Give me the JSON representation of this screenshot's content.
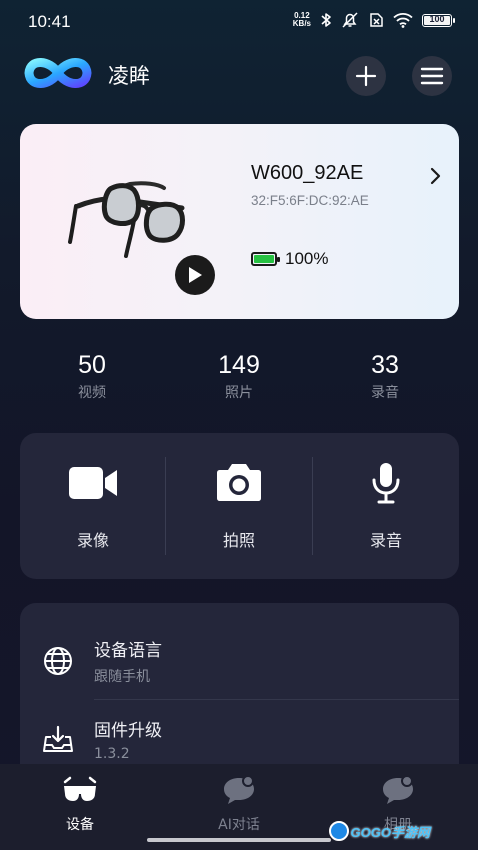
{
  "status_bar": {
    "time": "10:41",
    "net_speed_value": "0.12",
    "net_speed_unit": "KB/s",
    "battery_level": "100",
    "icons": [
      "bluetooth-icon",
      "mute-icon",
      "sim-x-icon",
      "wifi-icon",
      "battery-icon"
    ]
  },
  "header": {
    "app_name": "凌眸",
    "logo_icon": "infinity-logo-icon",
    "add_icon": "plus-icon",
    "menu_icon": "hamburger-icon"
  },
  "device": {
    "name": "W600_92AE",
    "mac": "32:F5:6F:DC:92:AE",
    "battery_text": "100%",
    "battery_fraction": 1.0,
    "battery_color": "#27c142"
  },
  "stats": [
    {
      "value": "50",
      "label": "视频"
    },
    {
      "value": "149",
      "label": "照片"
    },
    {
      "value": "33",
      "label": "录音"
    }
  ],
  "actions": [
    {
      "label": "录像",
      "icon": "video-camera-icon"
    },
    {
      "label": "拍照",
      "icon": "camera-icon"
    },
    {
      "label": "录音",
      "icon": "microphone-icon"
    }
  ],
  "settings": [
    {
      "title": "设备语言",
      "subtitle": "跟随手机",
      "icon": "globe-icon"
    },
    {
      "title": "固件升级",
      "subtitle": "1.3.2",
      "icon": "download-tray-icon"
    }
  ],
  "bottom_nav": [
    {
      "label": "设备",
      "icon": "glasses-icon",
      "active": true
    },
    {
      "label": "AI对话",
      "icon": "chat-bubble-icon",
      "active": false
    },
    {
      "label": "相册",
      "icon": "chat-bubble-icon",
      "active": false
    }
  ],
  "watermark": {
    "text": "GOGO手游网"
  }
}
